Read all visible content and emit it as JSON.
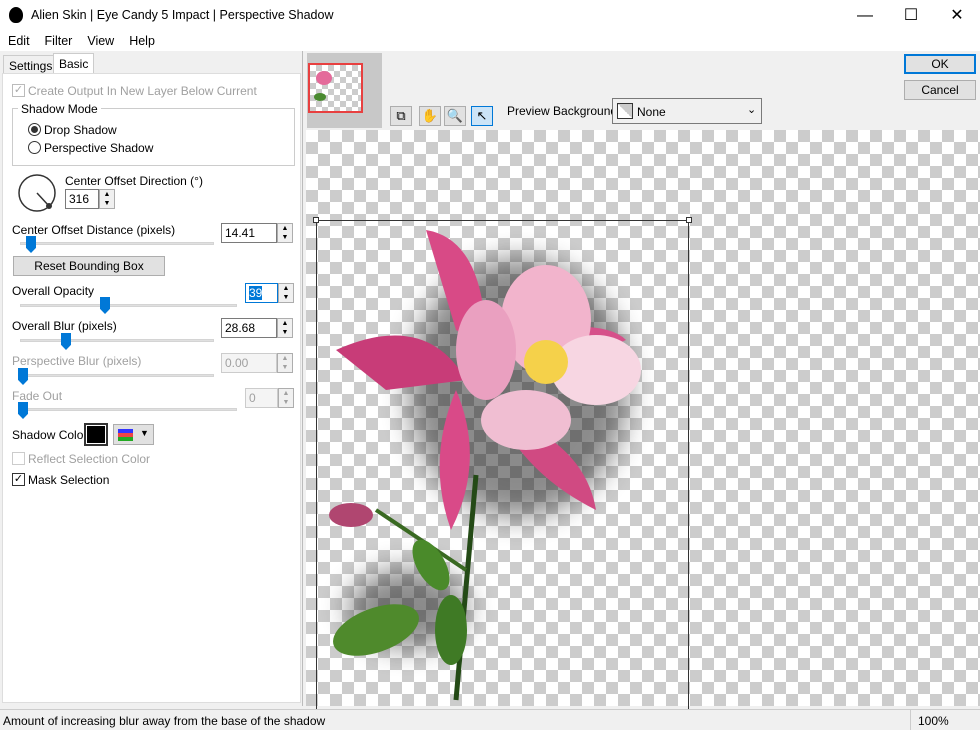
{
  "window": {
    "title": "Alien Skin | Eye Candy 5 Impact | Perspective Shadow",
    "minimize": "—",
    "maximize": "☐",
    "close": "✕"
  },
  "menu": [
    "Edit",
    "Filter",
    "View",
    "Help"
  ],
  "tabs": [
    "Settings",
    "Basic"
  ],
  "basic": {
    "create_output": "Create Output In New Layer Below Current",
    "shadow_mode_label": "Shadow Mode",
    "modes": [
      "Drop Shadow",
      "Perspective Shadow"
    ],
    "selected_mode": "Drop Shadow",
    "direction_label": "Center Offset Direction (°)",
    "direction_value": "316",
    "distance_label": "Center Offset Distance (pixels)",
    "distance_value": "14.41",
    "reset_label": "Reset Bounding Box",
    "opacity_label": "Overall Opacity",
    "opacity_value": "39",
    "blur_label": "Overall Blur (pixels)",
    "blur_value": "28.68",
    "persp_blur_label": "Perspective Blur (pixels)",
    "persp_blur_value": "0.00",
    "fade_label": "Fade Out",
    "fade_value": "0",
    "shadow_color_label": "Shadow Color",
    "shadow_color": "#000000",
    "reflect_label": "Reflect Selection Color",
    "mask_label": "Mask Selection",
    "mask_checked": true
  },
  "buttons": {
    "ok": "OK",
    "cancel": "Cancel"
  },
  "preview": {
    "bg_label": "Preview Background:",
    "bg_value": "None",
    "tools": [
      "preview-toggle-icon",
      "hand-icon",
      "zoom-icon",
      "pointer-icon"
    ],
    "active_tool": "pointer-icon"
  },
  "status": {
    "text": "Amount of increasing blur away from the base of the shadow",
    "zoom": "100%"
  }
}
